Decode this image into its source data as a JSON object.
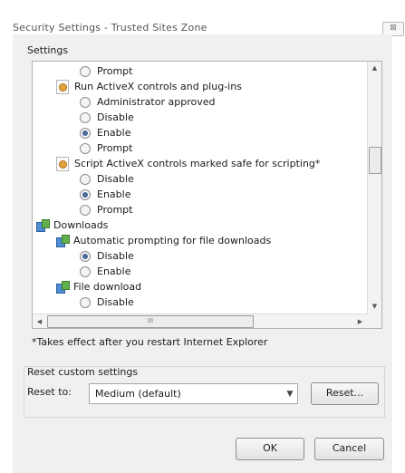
{
  "window": {
    "title": "Security Settings - Trusted Sites Zone",
    "close_glyph": "⊠"
  },
  "settings": {
    "group_label": "Settings",
    "items": [
      {
        "kind": "radio",
        "label": "Prompt",
        "checked": false,
        "indent": 2
      },
      {
        "kind": "heading",
        "icon": "page-icon",
        "label": "Run ActiveX controls and plug-ins",
        "indent": 1
      },
      {
        "kind": "radio",
        "label": "Administrator approved",
        "checked": false,
        "indent": 2
      },
      {
        "kind": "radio",
        "label": "Disable",
        "checked": false,
        "indent": 2
      },
      {
        "kind": "radio",
        "label": "Enable",
        "checked": true,
        "indent": 2
      },
      {
        "kind": "radio",
        "label": "Prompt",
        "checked": false,
        "indent": 2
      },
      {
        "kind": "heading",
        "icon": "page-icon",
        "label": "Script ActiveX controls marked safe for scripting*",
        "indent": 1
      },
      {
        "kind": "radio",
        "label": "Disable",
        "checked": false,
        "indent": 2
      },
      {
        "kind": "radio",
        "label": "Enable",
        "checked": true,
        "indent": 2
      },
      {
        "kind": "radio",
        "label": "Prompt",
        "checked": false,
        "indent": 2
      },
      {
        "kind": "category",
        "icon": "downloads-icon",
        "label": "Downloads",
        "indent": 0
      },
      {
        "kind": "heading",
        "icon": "downloads-icon",
        "label": "Automatic prompting for file downloads",
        "indent": 1
      },
      {
        "kind": "radio",
        "label": "Disable",
        "checked": true,
        "indent": 2
      },
      {
        "kind": "radio",
        "label": "Enable",
        "checked": false,
        "indent": 2
      },
      {
        "kind": "heading",
        "icon": "downloads-icon",
        "label": "File download",
        "indent": 1
      },
      {
        "kind": "radio",
        "label": "Disable",
        "checked": false,
        "indent": 2
      }
    ],
    "note": "*Takes effect after you restart Internet Explorer",
    "hscroll_grip": "III",
    "arrows": {
      "up": "▲",
      "down": "▼",
      "left": "◀",
      "right": "▶"
    }
  },
  "reset": {
    "group_label": "Reset custom settings",
    "label": "Reset to:",
    "selected": "Medium (default)",
    "dropdown_arrow": "▼",
    "button": "Reset..."
  },
  "footer": {
    "ok": "OK",
    "cancel": "Cancel"
  }
}
